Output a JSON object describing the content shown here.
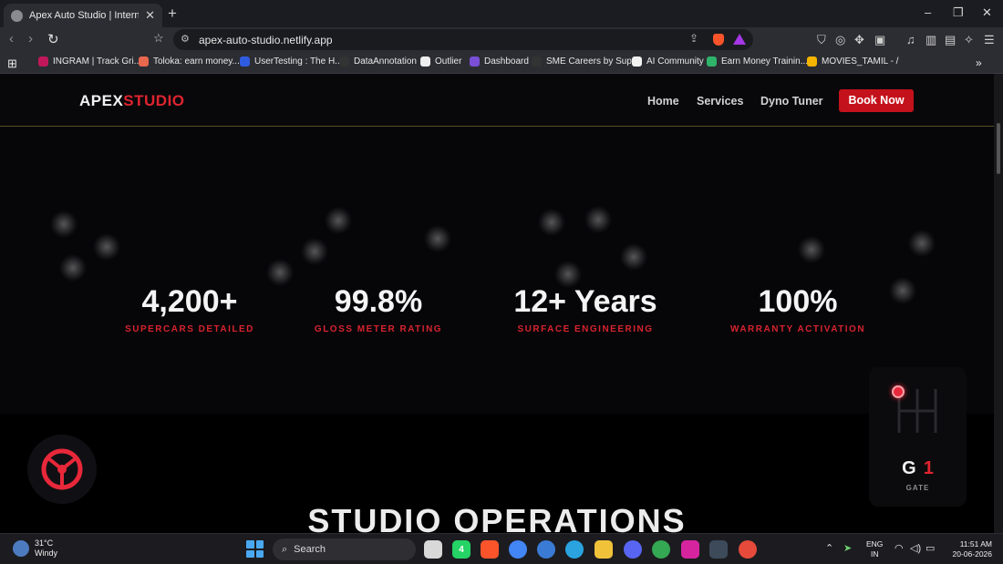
{
  "browser": {
    "tab_title": "Apex Auto Studio | International",
    "new_tab": "+",
    "url": "apex-auto-studio.netlify.app",
    "window_controls": {
      "minimize": "–",
      "maximize": "❐",
      "close": "✕"
    },
    "nav": {
      "back": "‹",
      "forward": "›",
      "reload": "↻"
    }
  },
  "bookmarks": [
    {
      "label": "INGRAM | Track Gri...",
      "color": "#c2185b"
    },
    {
      "label": "Toloka: earn money...",
      "color": "#e8674f"
    },
    {
      "label": "UserTesting : The H...",
      "color": "#2f5be0"
    },
    {
      "label": "DataAnnotation",
      "color": "#333333"
    },
    {
      "label": "Outlier",
      "color": "#eeeeee"
    },
    {
      "label": "Dashboard",
      "color": "#7a4fd6"
    },
    {
      "label": "SME Careers by Sup...",
      "color": "#333333"
    },
    {
      "label": "AI Community",
      "color": "#f2f2f2"
    },
    {
      "label": "Earn Money Trainin...",
      "color": "#2fb36b"
    },
    {
      "label": "MOVIES_TAMIL - /",
      "color": "#f4b400"
    }
  ],
  "bookmarks_overflow": "»",
  "site": {
    "logo_part1": "APEX",
    "logo_part2": "STUDIO",
    "nav": [
      "Home",
      "Services",
      "Dyno Tuner"
    ],
    "cta": "Book Now",
    "accent": "#e0242f"
  },
  "stats": [
    {
      "value": "4,200+",
      "label": "SUPERCARS DETAILED"
    },
    {
      "value": "99.8%",
      "label": "GLOSS METER RATING"
    },
    {
      "value": "12+ Years",
      "label": "SURFACE ENGINEERING"
    },
    {
      "value": "100%",
      "label": "WARRANTY ACTIVATION"
    }
  ],
  "section_title": "STUDIO OPERATIONS",
  "gear_widget": {
    "letter": "G",
    "number": "1",
    "label": "GATE"
  },
  "taskbar": {
    "temperature": "31°C",
    "weather": "Windy",
    "search": "Search",
    "lang_top": "ENG",
    "lang_bottom": "IN",
    "time": "11:51 AM",
    "date": "20-06-2026",
    "whatsapp_badge": "4"
  }
}
